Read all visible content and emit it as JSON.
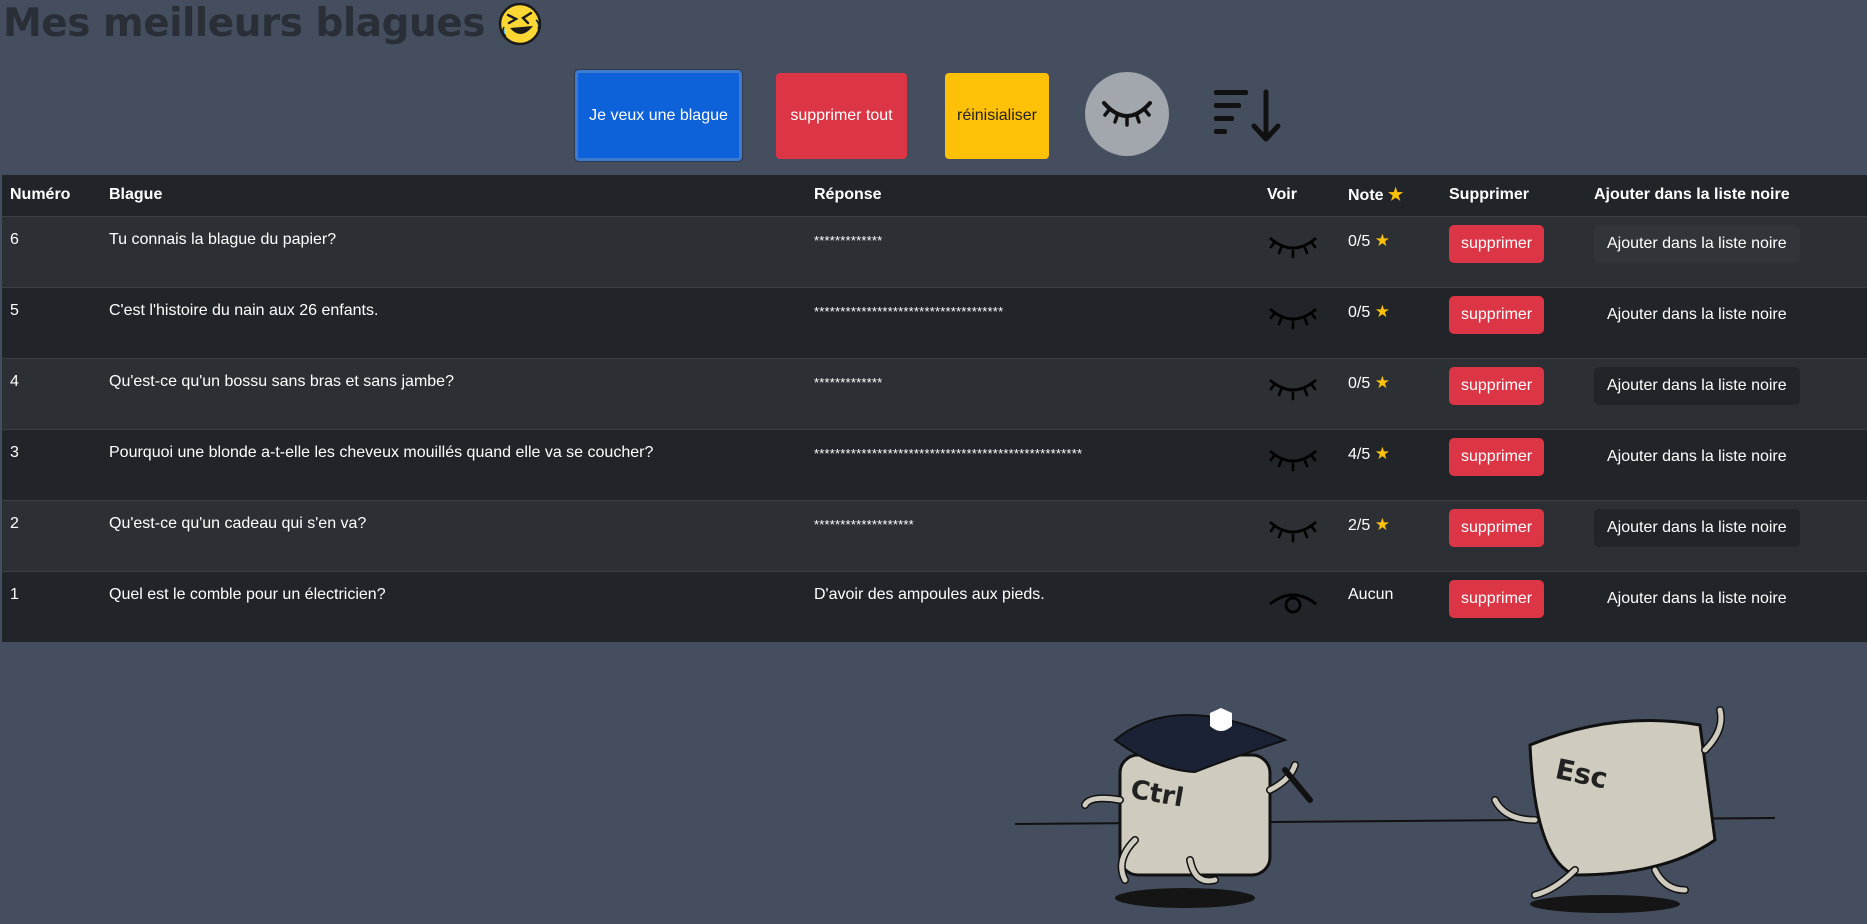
{
  "header": {
    "title": "Mes meilleurs blagues"
  },
  "toolbar": {
    "joke_button": "Je veux une blague",
    "delete_all_button": "supprimer tout",
    "reset_button": "réinisialiser"
  },
  "table": {
    "headers": [
      "Numéro",
      "Blague",
      "Réponse",
      "Voir",
      "Note",
      "Supprimer",
      "Ajouter dans la liste noire"
    ],
    "rows": [
      {
        "num": "6",
        "joke": "Tu connais la blague du papier?",
        "answer": "*************",
        "note": "0/5",
        "delete": "supprimer",
        "blacklist": "Ajouter dans la liste noire"
      },
      {
        "num": "5",
        "joke": "C'est l'histoire du nain aux 26 enfants.",
        "answer": "************************************",
        "note": "0/5",
        "delete": "supprimer",
        "blacklist": "Ajouter dans la liste noire"
      },
      {
        "num": "4",
        "joke": "Qu'est-ce qu'un bossu sans bras et sans jambe?",
        "answer": "*************",
        "note": "0/5",
        "delete": "supprimer",
        "blacklist": "Ajouter dans la liste noire"
      },
      {
        "num": "3",
        "joke": "Pourquoi une blonde a-t-elle les cheveux mouillés quand elle va se coucher?",
        "answer": "***************************************************",
        "note": "4/5",
        "delete": "supprimer",
        "blacklist": "Ajouter dans la liste noire"
      },
      {
        "num": "2",
        "joke": "Qu'est-ce qu'un cadeau qui s'en va?",
        "answer": "*******************",
        "note": "2/5",
        "delete": "supprimer",
        "blacklist": "Ajouter dans la liste noire"
      },
      {
        "num": "1",
        "joke": "Quel est le comble pour un électricien?",
        "answer": "D'avoir des ampoules aux pieds.",
        "note": "Aucun",
        "delete": "supprimer",
        "blacklist": "Ajouter dans la liste noire"
      }
    ]
  },
  "illustration": {
    "key_left": "Ctrl",
    "key_right": "Esc"
  },
  "colors": {
    "primary": "#0d61d9",
    "danger": "#dc3545",
    "warning": "#ffc107",
    "background": "#454e5f",
    "table": "#212529"
  }
}
